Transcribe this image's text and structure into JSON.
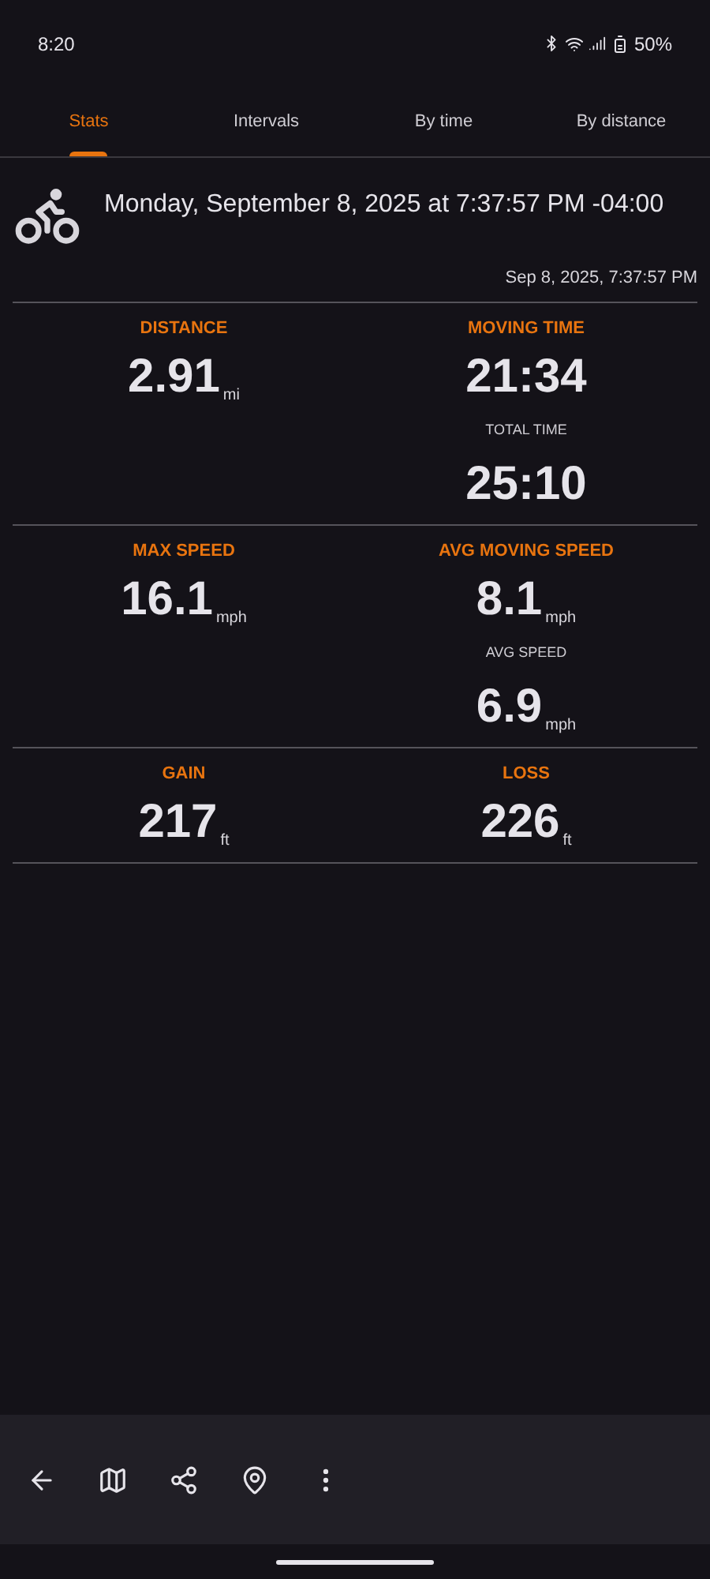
{
  "status_bar": {
    "time": "8:20",
    "battery": "50%"
  },
  "tabs": [
    {
      "label": "Stats",
      "selected": true
    },
    {
      "label": "Intervals",
      "selected": false
    },
    {
      "label": "By time",
      "selected": false
    },
    {
      "label": "By distance",
      "selected": false
    }
  ],
  "header": {
    "title": "Monday, September 8, 2025 at 7:37:57 PM -04:00",
    "timestamp": "Sep 8, 2025, 7:37:57 PM"
  },
  "rows": [
    {
      "left": {
        "label": "DISTANCE",
        "value": "2.91",
        "unit": "mi"
      },
      "right": {
        "label": "MOVING TIME",
        "value": "21:34",
        "sub": {
          "label": "TOTAL TIME",
          "value": "25:10"
        }
      }
    },
    {
      "left": {
        "label": "MAX SPEED",
        "value": "16.1",
        "unit": "mph"
      },
      "right": {
        "label": "AVG MOVING SPEED",
        "value": "8.1",
        "unit": "mph",
        "sub": {
          "label": "AVG SPEED",
          "value": "6.9",
          "unit": "mph"
        }
      }
    },
    {
      "left": {
        "label": "GAIN",
        "value": "217",
        "unit": "ft"
      },
      "right": {
        "label": "LOSS",
        "value": "226",
        "unit": "ft"
      }
    }
  ]
}
